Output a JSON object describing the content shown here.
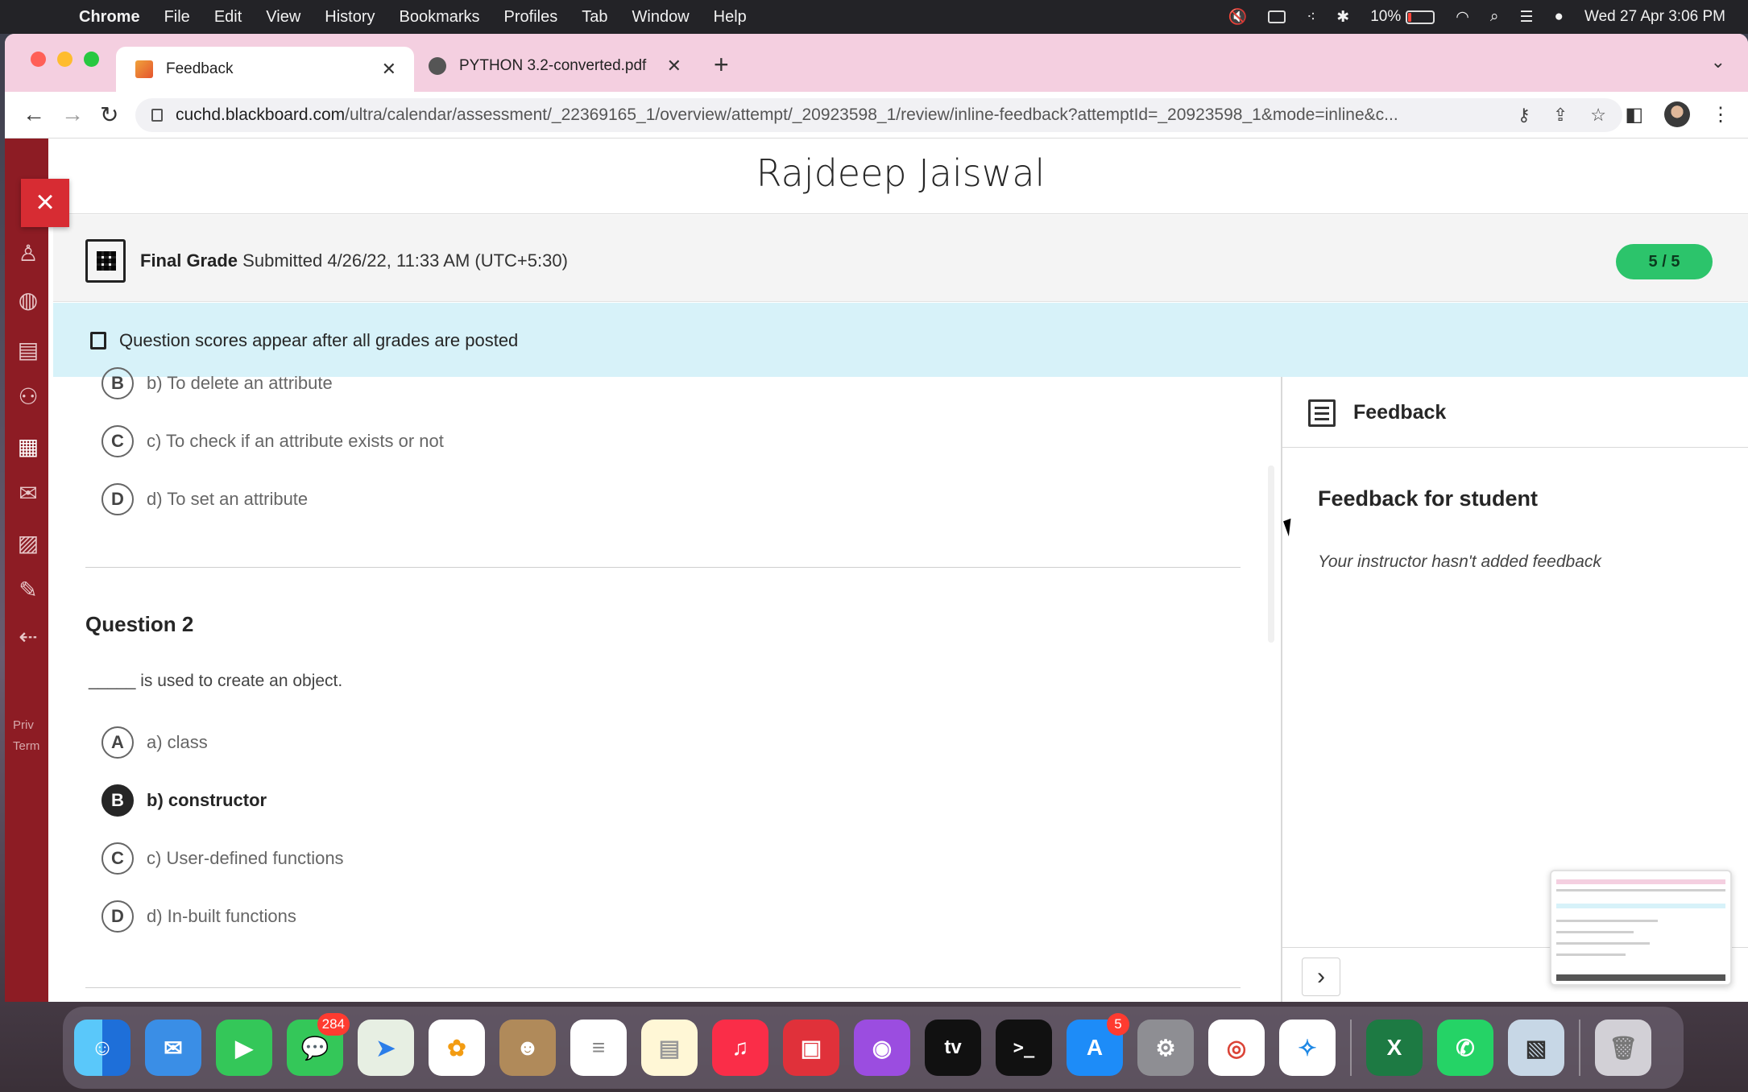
{
  "menubar": {
    "apple": "",
    "app": "Chrome",
    "items": [
      "File",
      "Edit",
      "View",
      "History",
      "Bookmarks",
      "Profiles",
      "Tab",
      "Window",
      "Help"
    ],
    "battery": "10%",
    "datetime": "Wed 27 Apr  3:06 PM"
  },
  "tabs": [
    {
      "title": "Feedback",
      "close": "✕"
    },
    {
      "title": "PYTHON 3.2-converted.pdf",
      "close": "✕"
    }
  ],
  "new_tab": "+",
  "url": {
    "host": "cuchd.blackboard.com",
    "path": "/ultra/calendar/assessment/_22369165_1/overview/attempt/_20923598_1/review/inline-feedback?attemptId=_20923598_1&mode=inline&c..."
  },
  "page": {
    "student_name": "Rajdeep Jaiswal",
    "grade_label": "Final Grade",
    "submitted": "Submitted 4/26/22, 11:33 AM (UTC+5:30)",
    "score": "5 / 5",
    "notice": "Question scores appear after all grades are posted",
    "sidebar_footer": [
      "Priv",
      "Term"
    ]
  },
  "question1_options": [
    {
      "letter": "B",
      "text": "b) To delete an attribute"
    },
    {
      "letter": "C",
      "text": "c) To check if an attribute exists or not"
    },
    {
      "letter": "D",
      "text": "d) To set an attribute"
    }
  ],
  "question2": {
    "title": "Question 2",
    "text": "_____ is used to create an object.",
    "options": [
      {
        "letter": "A",
        "text": "a) class"
      },
      {
        "letter": "B",
        "text": "b) constructor"
      },
      {
        "letter": "C",
        "text": "c) User-defined functions"
      },
      {
        "letter": "D",
        "text": "d) In-built functions"
      }
    ],
    "selected_index": 1
  },
  "feedback": {
    "header": "Feedback",
    "title": "Feedback for student",
    "empty_text": "Your instructor hasn't added feedback",
    "next": "›"
  },
  "dock": {
    "messages_badge": "284",
    "appstore_badge": "5",
    "tv_label": "tv"
  },
  "colors": {
    "sidebar": "#8d1c24",
    "close_button": "#d72c33",
    "score_pill": "#2cc46b",
    "notice_bg": "#d7f2f9",
    "tabstrip": "#f4cfe0"
  }
}
